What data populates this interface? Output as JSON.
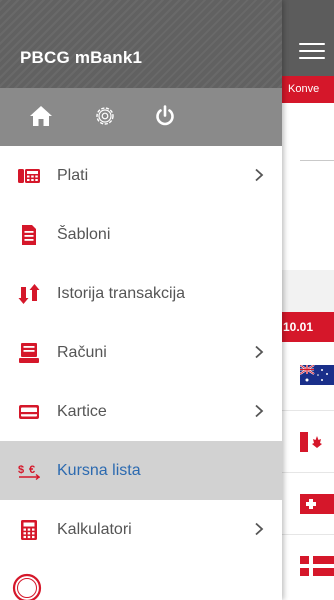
{
  "app": {
    "title": "PBCG mBank1"
  },
  "menu": {
    "items": [
      {
        "label": "Plati",
        "icon": "phone-icon",
        "has_submenu": true
      },
      {
        "label": "Šabloni",
        "icon": "document-icon",
        "has_submenu": false
      },
      {
        "label": "Istorija transakcija",
        "icon": "transaction-history-icon",
        "has_submenu": false
      },
      {
        "label": "Računi",
        "icon": "account-icon",
        "has_submenu": true
      },
      {
        "label": "Kartice",
        "icon": "card-icon",
        "has_submenu": true
      },
      {
        "label": "Kursna lista",
        "icon": "currency-exchange-icon",
        "has_submenu": false,
        "active": true
      },
      {
        "label": "Kalkulatori",
        "icon": "calculator-icon",
        "has_submenu": true
      }
    ]
  },
  "background": {
    "banner_text": "Konve",
    "date_text": "10.01"
  },
  "colors": {
    "accent": "#d5172a",
    "header_bg": "#616161",
    "toolbar_bg": "#8a8a8a",
    "active_item_bg": "#d2d2d2",
    "active_text": "#2c6ab0",
    "item_text": "#555555"
  }
}
